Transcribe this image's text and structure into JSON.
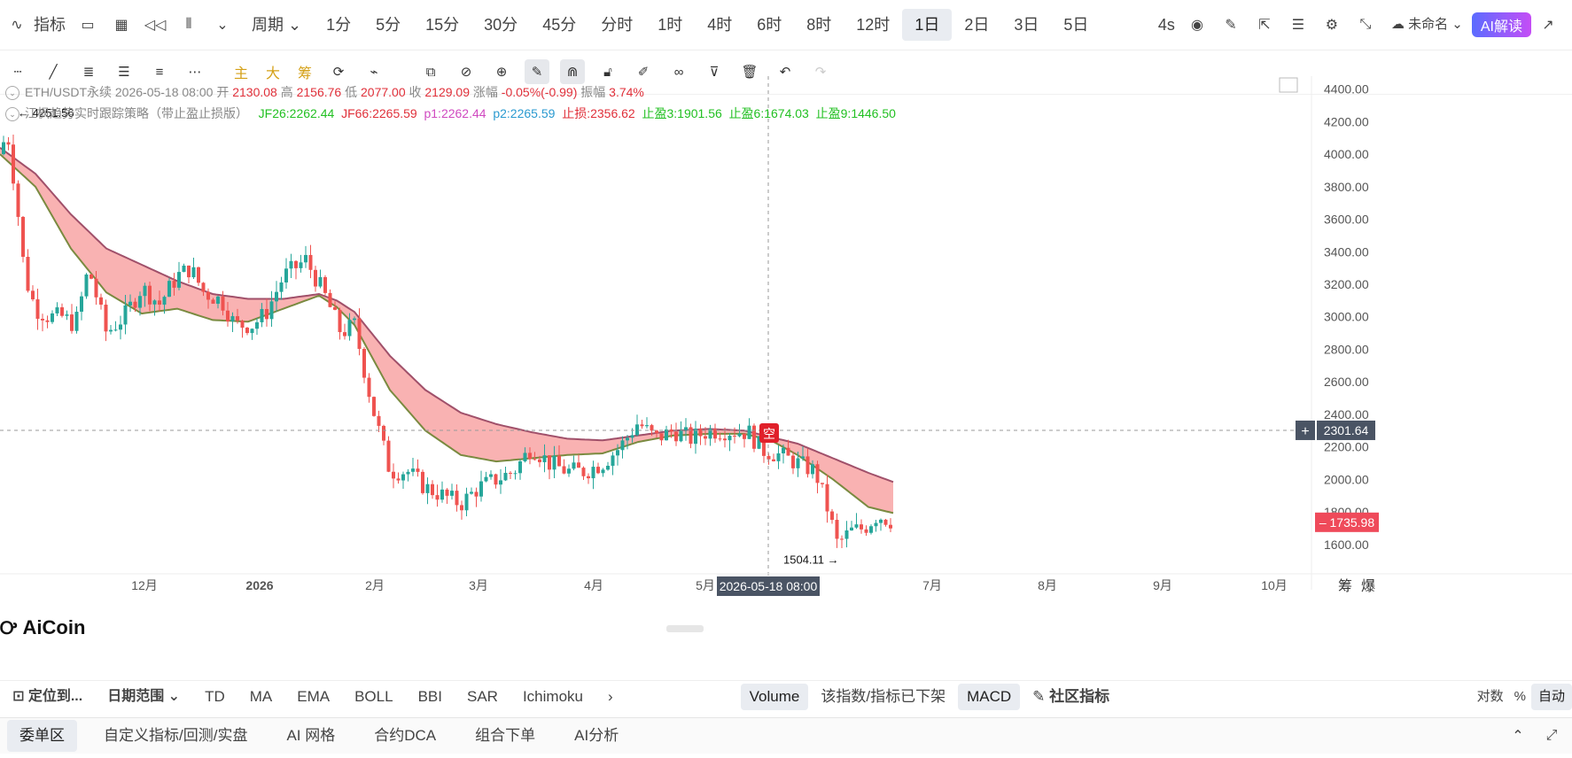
{
  "toolbar": {
    "indicator_label": "指标",
    "period_label": "周期",
    "timeframes": [
      "1分",
      "5分",
      "15分",
      "30分",
      "45分",
      "分时",
      "1时",
      "4时",
      "6时",
      "8时",
      "12时",
      "1日",
      "2日",
      "3日",
      "5日"
    ],
    "active_timeframe": "1日",
    "interval_badge": "4s",
    "layout_name": "未命名",
    "ai_button": "AI解读"
  },
  "drawbar": {
    "main_label": "主",
    "big_label": "大",
    "chip_label": "筹"
  },
  "info": {
    "symbol": "ETH/USDT永续",
    "datetime": "2026-05-18 08:00",
    "open_label": "开",
    "open": "2130.08",
    "high_label": "高",
    "high": "2156.76",
    "low_label": "低",
    "low": "2077.00",
    "close_label": "收",
    "close": "2129.09",
    "change_label": "涨幅",
    "change": "-0.05%(-0.99)",
    "amp_label": "振幅",
    "amp": "3.74%",
    "strategy": "江枫趋势实时跟踪策略（带止盈止损版）",
    "jf26": "JF26:2262.44",
    "jf66": "JF66:2265.59",
    "p1": "p1:2262.44",
    "p2": "p2:2265.59",
    "sl": "止损:2356.62",
    "tp3": "止盈3:1901.56",
    "tp6": "止盈6:1674.03",
    "tp9": "止盈9:1446.50"
  },
  "logo_text": "AiCoin",
  "indicators": {
    "locate": "定位到...",
    "date_range": "日期范围",
    "items": [
      "TD",
      "MA",
      "EMA",
      "BOLL",
      "BBI",
      "SAR",
      "Ichimoku"
    ],
    "volume": "Volume",
    "delisted": "该指数/指标已下架",
    "macd": "MACD",
    "community": "社区指标",
    "log": "对数",
    "percent": "%",
    "auto": "自动"
  },
  "bottom": {
    "tabs": [
      "委单区",
      "自定义指标/回测/实盘",
      "AI 网格",
      "合约DCA",
      "组合下单",
      "AI分析"
    ]
  },
  "chart_data": {
    "type": "candlestick",
    "y_ticks": [
      1600,
      1800,
      2000,
      2200,
      2400,
      2600,
      2800,
      3000,
      3200,
      3400,
      3600,
      3800,
      4000,
      4200,
      4400
    ],
    "y_tick_labels": [
      "1600.00",
      "1800.00",
      "2000.00",
      "2200.00",
      "2400.00",
      "2600.00",
      "2800.00",
      "3000.00",
      "3200.00",
      "3400.00",
      "3600.00",
      "3800.00",
      "4000.00",
      "4200.00",
      "4400.00"
    ],
    "ylim": [
      1430,
      4480
    ],
    "x_labels": [
      "12月",
      "2026",
      "2月",
      "3月",
      "4月",
      "5月",
      "7月",
      "8月",
      "9月",
      "10月"
    ],
    "crosshair_date": "2026-05-18 08:00",
    "crosshair_price": "2301.64",
    "last_price": "1735.98",
    "high_marker": "4251.56",
    "low_marker": "1504.11",
    "signal_label": "空",
    "right_labels": [
      "筹",
      "爆"
    ],
    "close_anchors": [
      [
        0,
        4000
      ],
      [
        8,
        4150
      ],
      [
        18,
        3750
      ],
      [
        28,
        3250
      ],
      [
        40,
        3050
      ],
      [
        55,
        3000
      ],
      [
        70,
        3000
      ],
      [
        85,
        2950
      ],
      [
        100,
        3300
      ],
      [
        120,
        2900
      ],
      [
        140,
        3000
      ],
      [
        160,
        3180
      ],
      [
        180,
        3080
      ],
      [
        200,
        3250
      ],
      [
        215,
        3300
      ],
      [
        230,
        3150
      ],
      [
        250,
        3100
      ],
      [
        265,
        2950
      ],
      [
        285,
        2950
      ],
      [
        300,
        3020
      ],
      [
        320,
        3250
      ],
      [
        345,
        3350
      ],
      [
        365,
        3150
      ],
      [
        385,
        2900
      ],
      [
        400,
        2950
      ],
      [
        420,
        2450
      ],
      [
        440,
        2050
      ],
      [
        460,
        2050
      ],
      [
        480,
        1950
      ],
      [
        500,
        1900
      ],
      [
        520,
        1850
      ],
      [
        540,
        1950
      ],
      [
        560,
        2000
      ],
      [
        580,
        2050
      ],
      [
        600,
        2200
      ],
      [
        620,
        2100
      ],
      [
        640,
        2050
      ],
      [
        660,
        2050
      ],
      [
        680,
        2100
      ],
      [
        700,
        2200
      ],
      [
        720,
        2350
      ],
      [
        740,
        2250
      ],
      [
        760,
        2300
      ],
      [
        780,
        2250
      ],
      [
        800,
        2300
      ],
      [
        820,
        2300
      ],
      [
        845,
        2290
      ],
      [
        860,
        2180
      ],
      [
        880,
        2150
      ],
      [
        900,
        2100
      ],
      [
        920,
        2050
      ],
      [
        935,
        1800
      ],
      [
        945,
        1600
      ],
      [
        960,
        1680
      ],
      [
        975,
        1700
      ],
      [
        990,
        1780
      ],
      [
        1010,
        1736
      ]
    ],
    "band_upper": [
      [
        0,
        4040
      ],
      [
        40,
        3880
      ],
      [
        80,
        3630
      ],
      [
        120,
        3420
      ],
      [
        160,
        3320
      ],
      [
        200,
        3220
      ],
      [
        240,
        3140
      ],
      [
        280,
        3110
      ],
      [
        320,
        3110
      ],
      [
        360,
        3140
      ],
      [
        380,
        3100
      ],
      [
        400,
        3030
      ],
      [
        440,
        2760
      ],
      [
        480,
        2550
      ],
      [
        520,
        2410
      ],
      [
        560,
        2340
      ],
      [
        600,
        2290
      ],
      [
        640,
        2250
      ],
      [
        680,
        2240
      ],
      [
        720,
        2270
      ],
      [
        760,
        2300
      ],
      [
        800,
        2310
      ],
      [
        840,
        2300
      ],
      [
        870,
        2260
      ],
      [
        900,
        2220
      ],
      [
        940,
        2130
      ],
      [
        980,
        2040
      ],
      [
        1010,
        1980
      ]
    ],
    "band_lower": [
      [
        0,
        4000
      ],
      [
        40,
        3800
      ],
      [
        80,
        3420
      ],
      [
        120,
        3150
      ],
      [
        160,
        3020
      ],
      [
        200,
        3050
      ],
      [
        240,
        2980
      ],
      [
        280,
        2970
      ],
      [
        320,
        3050
      ],
      [
        360,
        3130
      ],
      [
        380,
        3060
      ],
      [
        400,
        2950
      ],
      [
        440,
        2550
      ],
      [
        480,
        2300
      ],
      [
        520,
        2150
      ],
      [
        560,
        2110
      ],
      [
        600,
        2130
      ],
      [
        640,
        2150
      ],
      [
        680,
        2160
      ],
      [
        720,
        2230
      ],
      [
        760,
        2270
      ],
      [
        800,
        2280
      ],
      [
        840,
        2280
      ],
      [
        870,
        2240
      ],
      [
        900,
        2150
      ],
      [
        940,
        2000
      ],
      [
        980,
        1830
      ],
      [
        1010,
        1790
      ]
    ]
  },
  "colors": {
    "up": "#26a69a",
    "down": "#ef5350",
    "band_fill": "#f8a4a4",
    "band_upper_line": "#a0506a",
    "band_lower_line": "#7a8a40",
    "last_price_bg": "#ef4a5a",
    "crosshair_bg": "#4a5464"
  }
}
